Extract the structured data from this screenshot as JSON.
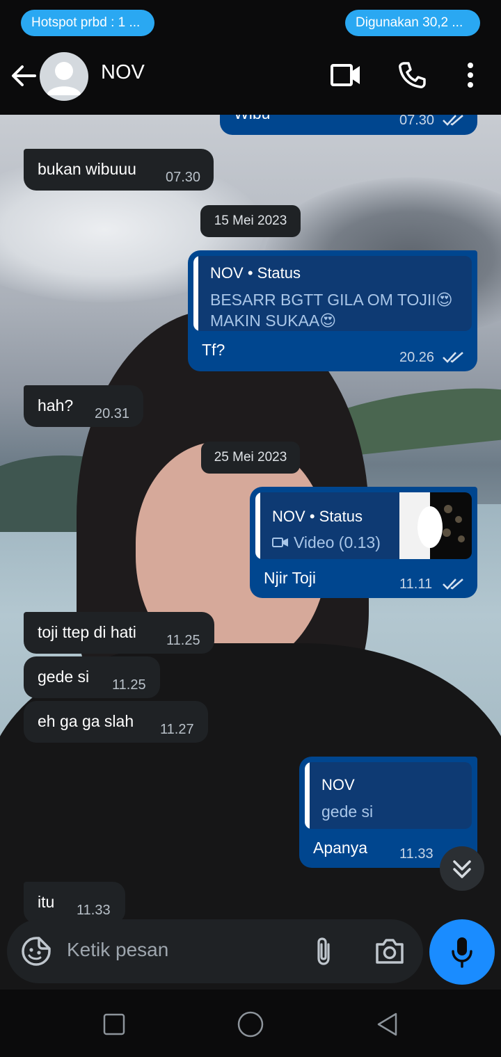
{
  "status_bar": {
    "left_pill": "Hotspot prbd : 1 ...",
    "right_pill": "Digunakan 30,2 ..."
  },
  "header": {
    "contact_name": "NOV",
    "icons": [
      "back-arrow-icon",
      "avatar-icon",
      "video-call-icon",
      "phone-call-icon",
      "more-options-icon"
    ]
  },
  "messages": [
    {
      "direction": "out",
      "text": "Wibu",
      "time": "07.30",
      "status": "read"
    },
    {
      "direction": "in",
      "text": "bukan wibuuu",
      "time": "07.30"
    },
    {
      "type": "date",
      "text": "15 Mei 2023"
    },
    {
      "direction": "out",
      "reply_to": {
        "name": "NOV",
        "source": "Status",
        "text": "BESARR BGTT GILA OM TOJII😍 MAKIN SUKAA😍"
      },
      "text": "Tf?",
      "time": "20.26",
      "status": "read"
    },
    {
      "direction": "in",
      "text": "hah?",
      "time": "20.31"
    },
    {
      "type": "date",
      "text": "25 Mei 2023"
    },
    {
      "direction": "out",
      "reply_to": {
        "name": "NOV",
        "source": "Status",
        "text": "Video (0.13)"
      },
      "text": "Njir Toji",
      "time": "11.11",
      "status": "read"
    },
    {
      "direction": "in",
      "text": "toji ttep di hati",
      "time": "11.25"
    },
    {
      "direction": "in",
      "text": "gede si",
      "time": "11.25"
    },
    {
      "direction": "in",
      "text": "eh ga ga slah",
      "time": "11.27"
    },
    {
      "direction": "out",
      "reply_to": {
        "name": "NOV",
        "text": "gede si"
      },
      "text": "Apanya",
      "time": "11.33"
    },
    {
      "direction": "in",
      "text": "itu",
      "time": "11.33"
    }
  ],
  "status_separator": "•",
  "input": {
    "placeholder": "Ketik pesan",
    "icons": [
      "sticker-icon",
      "attach-icon",
      "camera-icon",
      "mic-icon"
    ]
  },
  "navigation": [
    "recents-button",
    "home-button",
    "back-button"
  ],
  "colors": {
    "accent_blue": "#1a8cff",
    "outgoing_bubble": "#00468f",
    "incoming_bubble": "#1f2225",
    "hotspot_pill": "#2aa8f2"
  }
}
